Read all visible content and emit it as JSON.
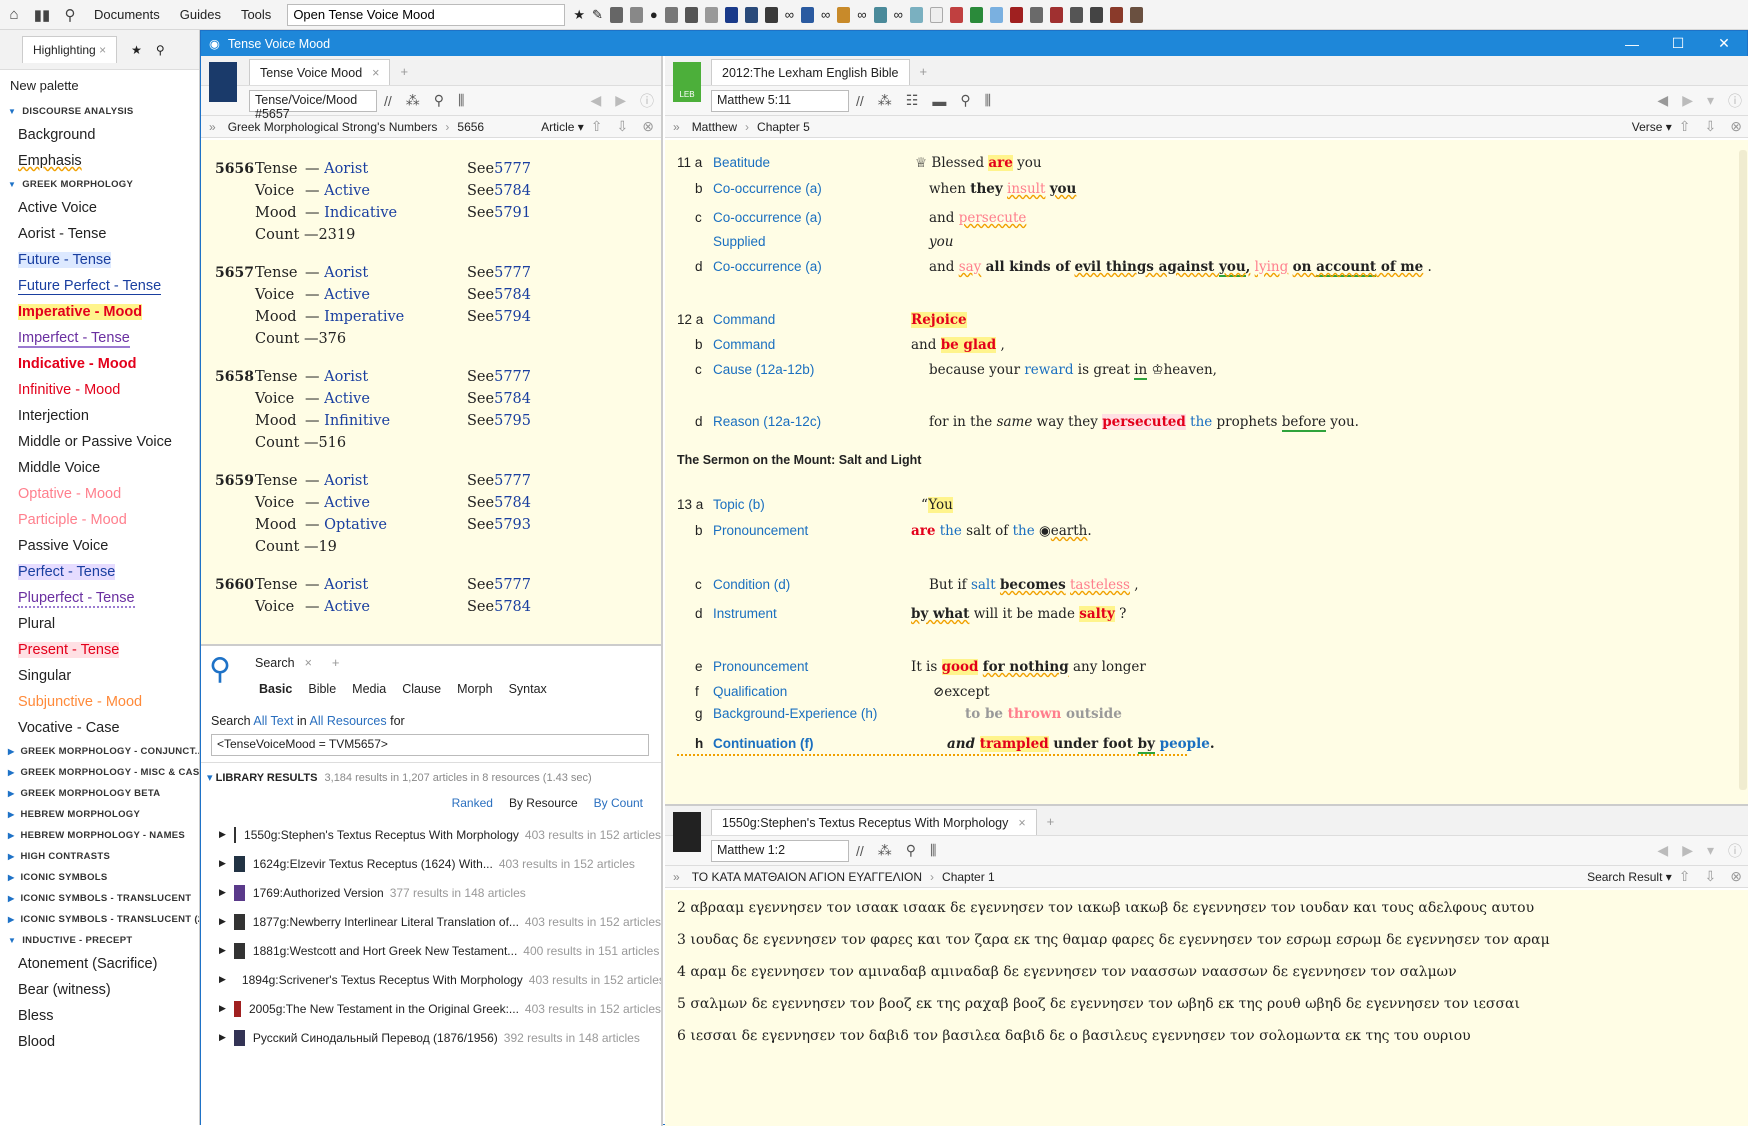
{
  "toolbar": {
    "menus": [
      "Documents",
      "Guides",
      "Tools"
    ],
    "command_box": "Open Tense Voice Mood"
  },
  "palette": {
    "tab": "Highlighting",
    "new_palette": "New palette",
    "sections": [
      {
        "title": "DISCOURSE ANALYSIS",
        "items": [
          {
            "label": "Background",
            "color": "#222",
            "deco": "none"
          },
          {
            "label": "Emphasis",
            "color": "#222",
            "deco": "wavy"
          }
        ]
      },
      {
        "title": "GREEK MORPHOLOGY",
        "items": [
          {
            "label": "Active Voice",
            "color": "#222",
            "deco": "none"
          },
          {
            "label": "Aorist - Tense",
            "color": "#222",
            "deco": "none"
          },
          {
            "label": "Future - Tense",
            "color": "#1a3fa0",
            "deco": "bg-blue"
          },
          {
            "label": "Future Perfect - Tense",
            "color": "#1a3fa0",
            "deco": "ul-blue"
          },
          {
            "label": "Imperative - Mood",
            "color": "#e3001b",
            "deco": "bold-yellow"
          },
          {
            "label": "Imperfect - Tense",
            "color": "#6a2fa0",
            "deco": "ul-purple"
          },
          {
            "label": "Indicative - Mood",
            "color": "#e3001b",
            "deco": "bold"
          },
          {
            "label": "Infinitive - Mood",
            "color": "#e3001b",
            "deco": "none"
          },
          {
            "label": "Interjection",
            "color": "#222",
            "deco": "none"
          },
          {
            "label": "Middle or Passive Voice",
            "color": "#222",
            "deco": "none"
          },
          {
            "label": "Middle Voice",
            "color": "#222",
            "deco": "none"
          },
          {
            "label": "Optative - Mood",
            "color": "#ff7f8d",
            "deco": "none"
          },
          {
            "label": "Participle - Mood",
            "color": "#ff7f8d",
            "deco": "none"
          },
          {
            "label": "Passive Voice",
            "color": "#222",
            "deco": "none"
          },
          {
            "label": "Perfect - Tense",
            "color": "#1a3fa0",
            "deco": "bg-purple"
          },
          {
            "label": "Pluperfect - Tense",
            "color": "#6a2fa0",
            "deco": "ul-dotted"
          },
          {
            "label": "Plural",
            "color": "#222",
            "deco": "none"
          },
          {
            "label": "Present - Tense",
            "color": "#e3001b",
            "deco": "bg-pink"
          },
          {
            "label": "Singular",
            "color": "#222",
            "deco": "none"
          },
          {
            "label": "Subjunctive - Mood",
            "color": "#ff8a3a",
            "deco": "none"
          },
          {
            "label": "Vocative - Case",
            "color": "#222",
            "deco": "none"
          }
        ]
      },
      {
        "title": "GREEK MORPHOLOGY - CONJUNCT...",
        "items": []
      },
      {
        "title": "GREEK MORPHOLOGY - MISC & CASE",
        "items": []
      },
      {
        "title": "GREEK MORPHOLOGY BETA",
        "items": []
      },
      {
        "title": "HEBREW MORPHOLOGY",
        "items": []
      },
      {
        "title": "HEBREW MORPHOLOGY - NAMES",
        "items": []
      },
      {
        "title": "HIGH CONTRASTS",
        "items": []
      },
      {
        "title": "ICONIC SYMBOLS",
        "items": []
      },
      {
        "title": "ICONIC SYMBOLS - TRANSLUCENT",
        "items": []
      },
      {
        "title": "ICONIC SYMBOLS - TRANSLUCENT (2",
        "items": []
      },
      {
        "title": "INDUCTIVE - PRECEPT",
        "items": [
          {
            "label": "Atonement (Sacrifice)",
            "color": "#222",
            "deco": "none"
          },
          {
            "label": "Bear (witness)",
            "color": "#222",
            "deco": "none"
          },
          {
            "label": "Bless",
            "color": "#222",
            "deco": "none"
          },
          {
            "label": "Blood",
            "color": "#222",
            "deco": "none"
          }
        ]
      }
    ]
  },
  "window": {
    "title": "Tense Voice Mood"
  },
  "tvm": {
    "tab": "Tense Voice Mood",
    "ref": "Tense/Voice/Mood #5657",
    "crumb_book": "Greek Morphological Strong's Numbers",
    "crumb_num": "5656",
    "crumb_right": "Article",
    "entries": [
      {
        "num": "5656",
        "rows": [
          [
            "Tense",
            "Aorist",
            "5777"
          ],
          [
            "Voice",
            "Active",
            "5784"
          ],
          [
            "Mood",
            "Indicative",
            "5791"
          ]
        ],
        "count": "2319"
      },
      {
        "num": "5657",
        "rows": [
          [
            "Tense",
            "Aorist",
            "5777"
          ],
          [
            "Voice",
            "Active",
            "5784"
          ],
          [
            "Mood",
            "Imperative",
            "5794"
          ]
        ],
        "count": "376"
      },
      {
        "num": "5658",
        "rows": [
          [
            "Tense",
            "Aorist",
            "5777"
          ],
          [
            "Voice",
            "Active",
            "5784"
          ],
          [
            "Mood",
            "Infinitive",
            "5795"
          ]
        ],
        "count": "516"
      },
      {
        "num": "5659",
        "rows": [
          [
            "Tense",
            "Aorist",
            "5777"
          ],
          [
            "Voice",
            "Active",
            "5784"
          ],
          [
            "Mood",
            "Optative",
            "5793"
          ]
        ],
        "count": "19"
      },
      {
        "num": "5660",
        "rows": [
          [
            "Tense",
            "Aorist",
            "5777"
          ],
          [
            "Voice",
            "Active",
            "5784"
          ]
        ],
        "count": ""
      }
    ],
    "see": "See",
    "count_label": "Count"
  },
  "search": {
    "tab": "Search",
    "kinds": [
      "Basic",
      "Bible",
      "Media",
      "Clause",
      "Morph",
      "Syntax"
    ],
    "prefix": "Search",
    "all_text": "All Text",
    "in": "in",
    "all_res": "All Resources",
    "for": "for",
    "query": "<TenseVoiceMood = TVM5657>",
    "lib_title": "LIBRARY RESULTS",
    "lib_summary": "3,184 results in 1,207 articles in 8 resources (1.43 sec)",
    "views": [
      "Ranked",
      "By Resource",
      "By Count"
    ],
    "results": [
      {
        "title": "1550g:Stephen's Textus Receptus With Morphology",
        "meta": "403 results in 152 articles",
        "color": "#333"
      },
      {
        "title": "1624g:Elzevir Textus Receptus (1624) With...",
        "meta": "403 results in 152 articles",
        "color": "#234"
      },
      {
        "title": "1769:Authorized Version",
        "meta": "377 results in 148 articles",
        "color": "#5a3a8a"
      },
      {
        "title": "1877g:Newberry Interlinear Literal Translation of...",
        "meta": "403 results in 152 articles",
        "color": "#333"
      },
      {
        "title": "1881g:Westcott and Hort Greek New Testament...",
        "meta": "400 results in 151 articles",
        "color": "#333"
      },
      {
        "title": "1894g:Scrivener's Textus Receptus With Morphology",
        "meta": "403 results in 152 articles",
        "color": "#333"
      },
      {
        "title": "2005g:The New Testament in the Original Greek:...",
        "meta": "403 results in 152 articles",
        "color": "#a02020"
      },
      {
        "title": "Русский Синодальный Перевод (1876/1956)",
        "meta": "392 results in 148 articles",
        "color": "#335"
      }
    ]
  },
  "leb": {
    "tab": "2012:The Lexham English Bible",
    "icon": "LEB",
    "ref": "Matthew 5:11",
    "crumb_book": "Matthew",
    "crumb_ch": "Chapter 5",
    "crumb_right": "Verse",
    "heading": "The Sermon on the Mount: Salt and Light"
  },
  "tr": {
    "tab": "1550g:Stephen's Textus Receptus With Morphology",
    "ref": "Matthew 1:2",
    "crumb_book": "ΤΟ ΚΑΤΑ ΜΑΤΘΑΙΟΝ ΑΓΙΟΝ ΕΥΑΓΓΕΛΙΟΝ",
    "crumb_ch": "Chapter 1",
    "crumb_right": "Search Result",
    "verses": [
      "2 αβρααμ εγεννησεν τον ισαακ ισαακ δε εγεννησεν τον ιακωβ ιακωβ δε εγεννησεν τον ιουδαν και τους αδελφους αυτου",
      "3 ιουδας δε εγεννησεν τον φαρες και τον ζαρα εκ της θαμαρ φαρες δε εγεννησεν τον εσρωμ εσρωμ δε εγεννησεν τον αραμ",
      "4 αραμ δε εγεννησεν τον αμιναδαβ αμιναδαβ δε εγεννησεν τον ναασσων ναασσων δε εγεννησεν τον σαλμων",
      "5 σαλμων δε εγεννησεν τον βοοζ εκ της ραχαβ βοοζ δε εγεννησεν τον ωβηδ εκ της ρουθ ωβηδ δε εγεννησεν τον ιεσσαι",
      "6 ιεσσαι δε εγεννησεν τον δαβιδ τον βασιλεα δαβιδ δε ο βασιλευς εγεννησεν τον σολομωντα εκ της του ουριου"
    ]
  }
}
